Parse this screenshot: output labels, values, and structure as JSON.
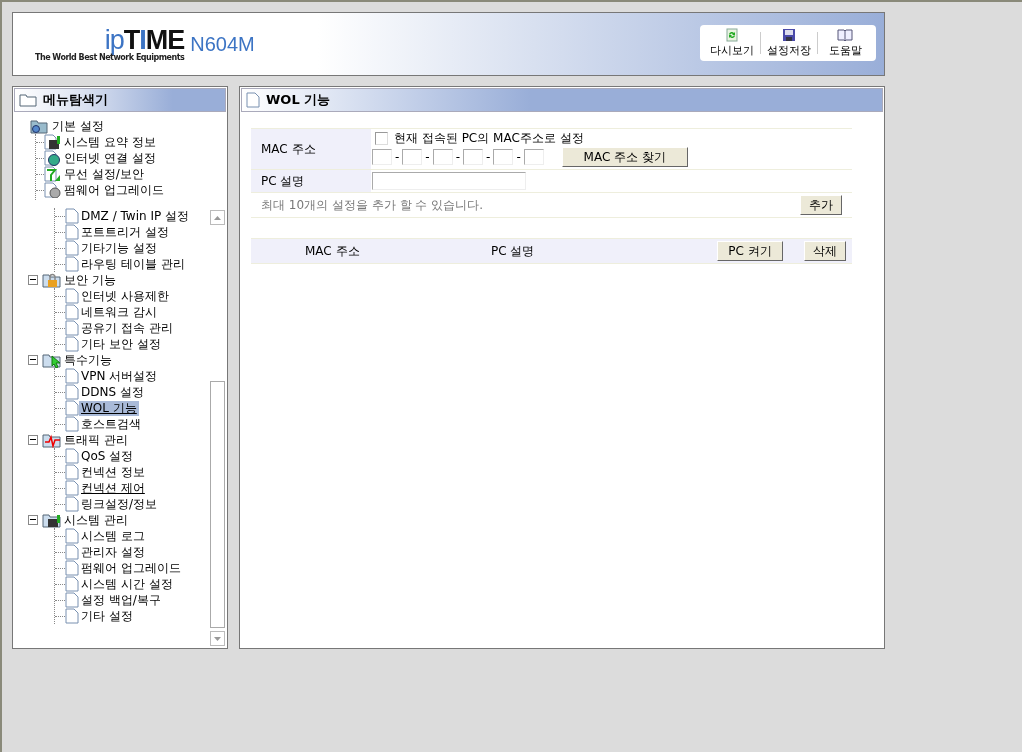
{
  "header": {
    "brand": [
      {
        "text": "ip",
        "kind": "light"
      },
      {
        "text": "T",
        "kind": "bold"
      },
      {
        "text": "I",
        "kind": "accent"
      },
      {
        "text": "ME",
        "kind": "bold"
      }
    ],
    "tagline": "The World Best Network Equipments",
    "model": "N604M",
    "toolbar": [
      {
        "label": "다시보기",
        "kind": "refresh"
      },
      {
        "label": "설정저장",
        "kind": "save"
      },
      {
        "label": "도움말",
        "kind": "help"
      }
    ]
  },
  "sidebar": {
    "title": "메뉴탐색기",
    "root": {
      "label": "기본 설정",
      "children": [
        {
          "label": "시스템 요약 정보",
          "kind": "monitor",
          "selected": false
        },
        {
          "label": "인터넷 연결 설정",
          "kind": "globe",
          "selected": false
        },
        {
          "label": "무선 설정/보안",
          "kind": "antenna",
          "selected": false
        },
        {
          "label": "펌웨어 업그레이드",
          "kind": "disc",
          "selected": false
        }
      ]
    },
    "groups": [
      {
        "children": [
          {
            "label": "DMZ / Twin IP 설정",
            "selected": false,
            "hovered": false
          },
          {
            "label": "포트트리거 설정",
            "selected": false,
            "hovered": false
          },
          {
            "label": "기타기능 설정",
            "selected": false,
            "hovered": false
          },
          {
            "label": "라우팅 테이블 관리",
            "selected": false,
            "hovered": false
          }
        ]
      },
      {
        "label": "보안 기능",
        "kind": "lock",
        "expanded": true,
        "children": [
          {
            "label": "인터넷 사용제한",
            "selected": false,
            "hovered": false
          },
          {
            "label": "네트워크 감시",
            "selected": false,
            "hovered": false
          },
          {
            "label": "공유기 접속 관리",
            "selected": false,
            "hovered": false
          },
          {
            "label": "기타 보안 설정",
            "selected": false,
            "hovered": false
          }
        ]
      },
      {
        "label": "특수기능",
        "kind": "cursor",
        "expanded": true,
        "children": [
          {
            "label": "VPN 서버설정",
            "selected": false,
            "hovered": false
          },
          {
            "label": "DDNS 설정",
            "selected": false,
            "hovered": false
          },
          {
            "label": "WOL 기능",
            "selected": true,
            "hovered": true
          },
          {
            "label": "호스트검색",
            "selected": false,
            "hovered": false
          }
        ]
      },
      {
        "label": "트래픽 관리",
        "kind": "pulse",
        "expanded": true,
        "children": [
          {
            "label": "QoS 설정",
            "selected": false,
            "hovered": false
          },
          {
            "label": "컨넥션 정보",
            "selected": false,
            "hovered": false
          },
          {
            "label": "컨넥션 제어",
            "selected": false,
            "hovered": true
          },
          {
            "label": "링크설정/정보",
            "selected": false,
            "hovered": false
          }
        ]
      },
      {
        "label": "시스템 관리",
        "kind": "monitor",
        "expanded": true,
        "children": [
          {
            "label": "시스템 로그",
            "selected": false,
            "hovered": false
          },
          {
            "label": "관리자 설정",
            "selected": false,
            "hovered": false
          },
          {
            "label": "펌웨어 업그레이드",
            "selected": false,
            "hovered": false
          },
          {
            "label": "시스템 시간 설정",
            "selected": false,
            "hovered": false
          },
          {
            "label": "설정 백업/복구",
            "selected": false,
            "hovered": false
          },
          {
            "label": "기타 설정",
            "selected": false,
            "hovered": false
          }
        ]
      }
    ]
  },
  "content": {
    "title": "WOL 기능",
    "form": {
      "mac_label": "MAC 주소",
      "use_current": {
        "label": "현재 접속된 PC의 MAC주소로 설정",
        "checked": false
      },
      "mac_separators": [
        "-",
        "-",
        "-",
        "-",
        "-"
      ],
      "find_button": "MAC 주소 찾기",
      "desc_label": "PC 설명",
      "note": "최대 10개의 설정을 추가 할 수 있습니다.",
      "add_button": "추가"
    },
    "list": {
      "columns": [
        "MAC 주소",
        "PC 설명"
      ],
      "buttons": [
        "PC 켜기",
        "삭제"
      ]
    }
  }
}
